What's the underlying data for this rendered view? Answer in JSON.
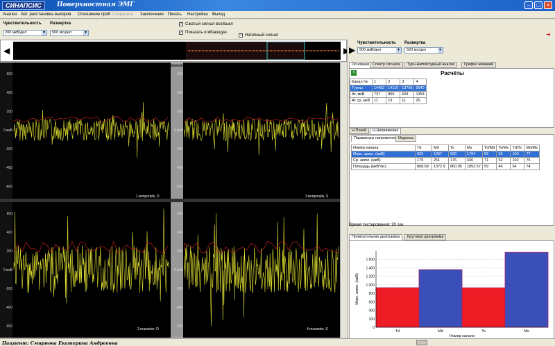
{
  "window": {
    "logo": "СИНАПСИС",
    "title": "Поверхностная ЭМГ",
    "btn_min": "–",
    "btn_max": "□",
    "btn_close": "×"
  },
  "menu": [
    "Анализ",
    "Авт. расстановка выхоров",
    "Отношение проб",
    "Сохранить",
    "Заключение",
    "Печать",
    "Настройка",
    "Выход"
  ],
  "toolbar": {
    "sens_label": "Чувствительность",
    "sens_value": "200 мкВ/дел",
    "sweep_label": "Развертка",
    "sweep_value": "500 мс/дел",
    "cb1": "Сжатый сигнал вкл/выкл",
    "cb2": "Показать огибающую",
    "cb3": "Нативный сигнал",
    "cb_mark": "✓"
  },
  "overview": {
    "left": "◀",
    "right": "▶"
  },
  "plot": {
    "title": "Н.Напряжение",
    "yticks": [
      "600",
      "400",
      "200",
      "0 мкВ",
      "-200",
      "-400",
      "-600"
    ],
    "channels": [
      "1.temporalis, D",
      "3.temporalis, S",
      "2.masseter, D",
      "4.masseter, S"
    ]
  },
  "right": {
    "sens_label": "Чувствительность",
    "sens_value": "500 мкВ/дел",
    "sweep_label": "Развертка",
    "sweep_value": "500 мс/дел",
    "tabs": [
      "Основная",
      "Спектр сигнала",
      "Турн-Амплитудный анализ",
      "График жеваний"
    ],
    "calc_title": "Расчёты",
    "calc_icon": "+",
    "calc_header": [
      "Канал №",
      "1",
      "2",
      "3",
      "4"
    ],
    "calc_rows": [
      [
        "Турны",
        "14482",
        "14110",
        "13708",
        "9540"
      ],
      [
        "Ат, мкВ",
        "737",
        "850",
        "603",
        "1353"
      ],
      [
        "Ат ср, мкВ",
        "11",
        "19",
        "11",
        "25"
      ]
    ],
    "subtabs": [
      "Н.Покой",
      "Н.Напряжение"
    ],
    "subtabs2": [
      "Параметры напряжения",
      "Индексы"
    ],
    "param_header": [
      "Номер канала",
      "Td",
      "Md",
      "Ts",
      "Ms",
      "Td/Md",
      "Ts/Ms",
      "Td/Ts",
      "Md/Ms"
    ],
    "param_rows": [
      [
        "Макс. ампл. (мкВ)",
        "932",
        "1357",
        "930",
        "1764",
        "69",
        "53",
        "100",
        "77"
      ],
      [
        "Ср. ампл. (мкВ)",
        "179",
        "251",
        "176",
        "336",
        "71",
        "52",
        "102",
        "75"
      ],
      [
        "Площадь (мкВ*мс)",
        "808.69",
        "1372.9",
        "860.95",
        "1852.57",
        "59",
        "46",
        "54",
        "74"
      ]
    ],
    "test_time": "Время тестирования: 20 сек",
    "chart_tabs": [
      "Прямоугольная диаграмма",
      "Круговая диаграмма"
    ]
  },
  "status": {
    "patient": "Пациент: Смирнова Екатерина Андреевна"
  },
  "colors": {
    "signal": "#e6e633",
    "envelope": "#c02020",
    "bar_red": "#ee1c24",
    "bar_blue": "#3a4fb8"
  },
  "chart_data": {
    "type": "bar",
    "categories": [
      "Td",
      "Md",
      "Ts",
      "Ms"
    ],
    "values": [
      932,
      1357,
      930,
      1764
    ],
    "xlabel": "Номер канала",
    "ylabel": "Макс. ампл. (мкВ)",
    "yticks": [
      "0",
      "200",
      "400",
      "600",
      "800",
      "1 000",
      "1 200",
      "1 400",
      "1 600"
    ],
    "ylim": [
      0,
      1800
    ],
    "bar_colors": [
      "#ee1c24",
      "#3a4fb8",
      "#ee1c24",
      "#3a4fb8"
    ],
    "grid": true
  }
}
